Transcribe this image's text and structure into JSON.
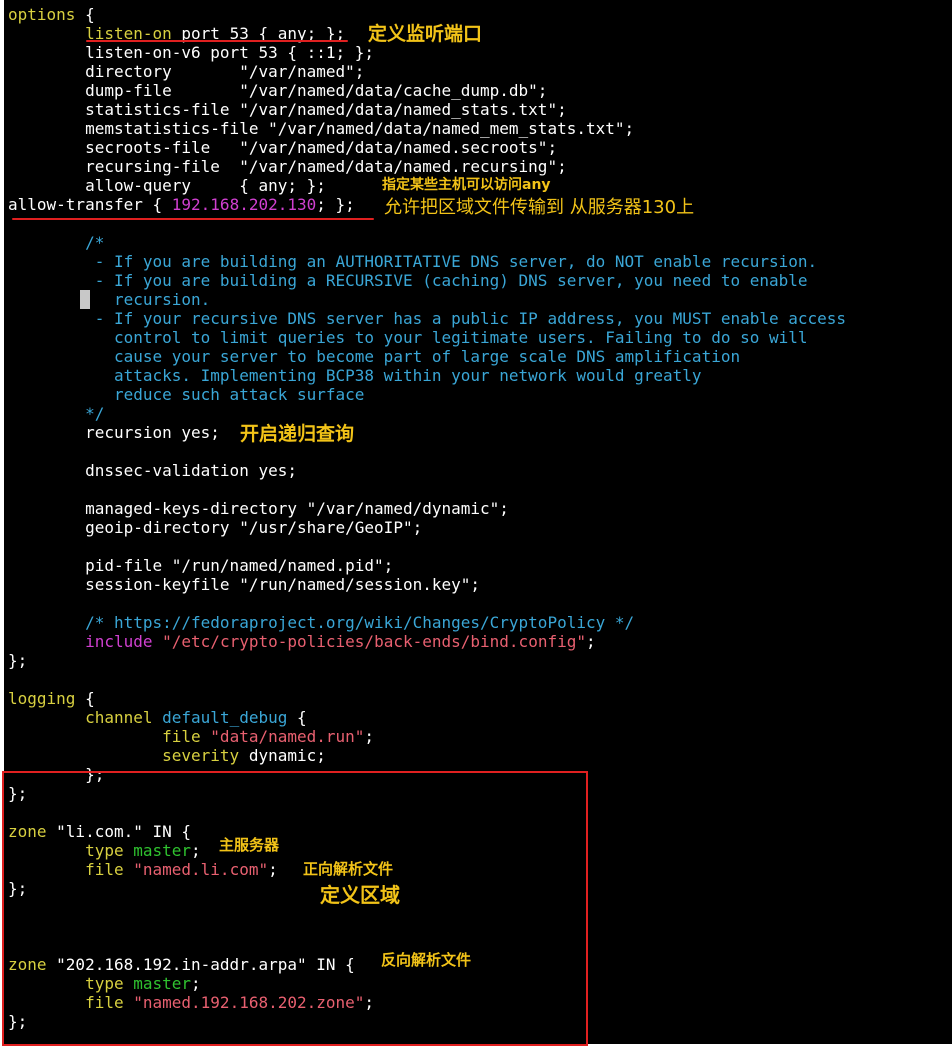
{
  "code": {
    "l1": [
      "options",
      " {"
    ],
    "l2": [
      "        ",
      "listen-on",
      " port 53 { any; };"
    ],
    "l3": [
      "        listen-on-v6 port 53 { ::1; };"
    ],
    "l4": [
      "        directory       \"/var/named\";"
    ],
    "l5": [
      "        dump-file       \"/var/named/data/cache_dump.db\";"
    ],
    "l6": [
      "        statistics-file \"/var/named/data/named_stats.txt\";"
    ],
    "l7": [
      "        memstatistics-file \"/var/named/data/named_mem_stats.txt\";"
    ],
    "l8": [
      "        secroots-file   \"/var/named/data/named.secroots\";"
    ],
    "l9": [
      "        recursing-file  \"/var/named/data/named.recursing\";"
    ],
    "l10": [
      "        allow-query     { any; };"
    ],
    "l11": [
      "allow-transfer { ",
      "192.168.202.130",
      "; };"
    ],
    "l12": [
      "        /*"
    ],
    "l13": [
      "         - If you are building an AUTHORITATIVE DNS server, do NOT enable recursion."
    ],
    "l14": [
      "         - If you are building a RECURSIVE (caching) DNS server, you need to enable"
    ],
    "l15": [
      "           recursion."
    ],
    "l16": [
      "         - If your recursive DNS server has a public IP address, you MUST enable access"
    ],
    "l17": [
      "           control to limit queries to your legitimate users. Failing to do so will"
    ],
    "l18": [
      "           cause your server to become part of large scale DNS amplification"
    ],
    "l19": [
      "           attacks. Implementing BCP38 within your network would greatly"
    ],
    "l20": [
      "           reduce such attack surface"
    ],
    "l21": [
      "        */"
    ],
    "l22": [
      "        recursion yes;"
    ],
    "l23": [
      "        dnssec-validation yes;"
    ],
    "l24": [
      "        managed-keys-directory \"/var/named/dynamic\";"
    ],
    "l25": [
      "        geoip-directory \"/usr/share/GeoIP\";"
    ],
    "l26": [
      "        pid-file \"/run/named/named.pid\";"
    ],
    "l27": [
      "        session-keyfile \"/run/named/session.key\";"
    ],
    "l28": [
      "        /* https://fedoraproject.org/wiki/Changes/CryptoPolicy */"
    ],
    "l29": [
      "        ",
      "include",
      " ",
      "\"/etc/crypto-policies/back-ends/bind.config\"",
      ";"
    ],
    "l30": [
      "};"
    ],
    "l31": [
      "logging",
      " {"
    ],
    "l32": [
      "        ",
      "channel",
      " ",
      "default_debug",
      " {"
    ],
    "l33": [
      "                ",
      "file",
      " ",
      "\"data/named.run\"",
      ";"
    ],
    "l34": [
      "                ",
      "severity",
      " dynamic;"
    ],
    "l35": [
      "        };"
    ],
    "l36": [
      "};"
    ],
    "l37": [
      "zone",
      " \"li.com.\" IN {"
    ],
    "l38": [
      "        ",
      "type",
      " ",
      "master",
      ";"
    ],
    "l39": [
      "        ",
      "file",
      " ",
      "\"named.li.com\"",
      ";"
    ],
    "l40": [
      "};"
    ],
    "l41": [
      "zone",
      " \"202.168.192.in-addr.arpa\" IN {"
    ],
    "l42": [
      "        ",
      "type",
      " ",
      "master",
      ";"
    ],
    "l43": [
      "        ",
      "file",
      " ",
      "\"named.192.168.202.zone\"",
      ";"
    ],
    "l44": [
      "};"
    ]
  },
  "annotations": {
    "listen_port": "定义监听端口",
    "allow_query": "指定某些主机可以访问any",
    "allow_transfer": "允许把区域文件传输到 从服务器130上",
    "recursion": "开启递归查询",
    "master": "主服务器",
    "forward_file": "正向解析文件",
    "define_zone": "定义区域",
    "reverse_file": "反向解析文件"
  },
  "colors": {
    "background": "#000000",
    "text": "#ffffff",
    "keyword": "#d8d040",
    "comment": "#3aa6d6",
    "string": "#e86070",
    "ip": "#d040d0",
    "value": "#2fc22f",
    "annotation": "#f2c318",
    "markup_red": "#e02020"
  }
}
